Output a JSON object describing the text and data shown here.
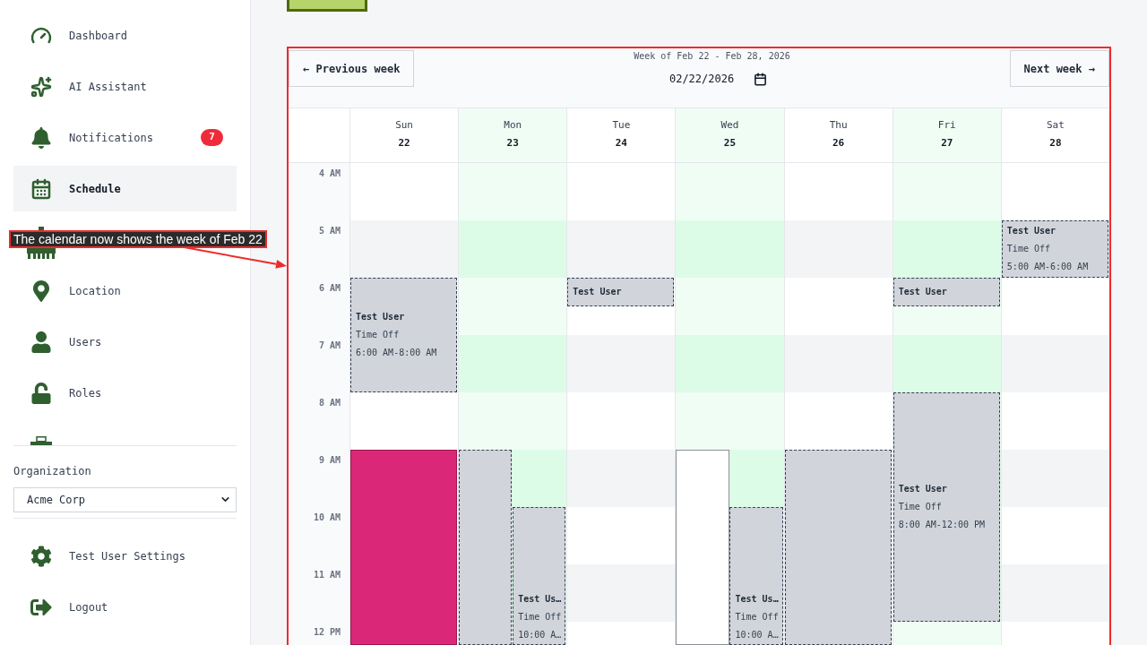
{
  "sidebar": {
    "nav_items": [
      {
        "kind": "link",
        "label": "Dashboard",
        "selected": false
      },
      {
        "kind": "link",
        "label": "AI Assistant",
        "selected": false
      },
      {
        "kind": "link",
        "label": "Notifications",
        "selected": false,
        "badge": "7"
      },
      {
        "kind": "link",
        "label": "Schedule",
        "selected": true
      },
      {
        "kind": "covered",
        "selected": false
      },
      {
        "kind": "link",
        "label": "Location",
        "selected": false
      },
      {
        "kind": "link",
        "label": "Users",
        "selected": false
      },
      {
        "kind": "link",
        "label": "Roles",
        "selected": false
      },
      {
        "kind": "clipped",
        "selected": false
      }
    ],
    "organization": {
      "label": "Organization",
      "value": "Acme Corp"
    },
    "footer_items": [
      {
        "label": "Test User Settings"
      },
      {
        "label": "Logout"
      }
    ]
  },
  "calendar": {
    "prev_button": "← Previous week",
    "range_label": "Week of Feb 22 - Feb 28, 2026",
    "date_value": "02/22/2026",
    "next_button": "Next week →",
    "hours": [
      "4 AM",
      "5 AM",
      "6 AM",
      "7 AM",
      "8 AM",
      "9 AM",
      "10 AM",
      "11 AM",
      "12 PM"
    ],
    "days": [
      {
        "name": "Sun",
        "date": "22",
        "highlighted": false,
        "lanes": [
          {
            "slots": [
              {
                "kind": "free"
              },
              {
                "kind": "free"
              },
              {
                "kind": "free"
              },
              {
                "kind": "free"
              },
              {
                "kind": "time_off",
                "title": "Test User",
                "type": "Time Off",
                "time": "6:00 AM-8:00 AM"
              },
              {
                "kind": "more"
              },
              {
                "kind": "more"
              },
              {
                "kind": "more"
              },
              {
                "kind": "free"
              },
              {
                "kind": "free"
              },
              {
                "kind": "shift",
                "color": "#db2777"
              },
              {
                "kind": "more"
              },
              {
                "kind": "more"
              },
              {
                "kind": "more"
              },
              {
                "kind": "more"
              },
              {
                "kind": "more"
              },
              {
                "kind": "more"
              }
            ]
          }
        ]
      },
      {
        "name": "Mon",
        "date": "23",
        "highlighted": true,
        "lanes": [
          {
            "slots": [
              {
                "kind": "free"
              },
              {
                "kind": "free"
              },
              {
                "kind": "free"
              },
              {
                "kind": "free"
              },
              {
                "kind": "free"
              },
              {
                "kind": "free"
              },
              {
                "kind": "free"
              },
              {
                "kind": "free"
              },
              {
                "kind": "free"
              },
              {
                "kind": "free"
              },
              {
                "kind": "time_off"
              },
              {
                "kind": "more"
              },
              {
                "kind": "more"
              },
              {
                "kind": "more"
              },
              {
                "kind": "more"
              },
              {
                "kind": "more"
              },
              {
                "kind": "more"
              }
            ]
          },
          {
            "slots": [
              {
                "kind": "free"
              },
              {
                "kind": "free"
              },
              {
                "kind": "free"
              },
              {
                "kind": "free"
              },
              {
                "kind": "free"
              },
              {
                "kind": "free"
              },
              {
                "kind": "free"
              },
              {
                "kind": "free"
              },
              {
                "kind": "free"
              },
              {
                "kind": "free"
              },
              {
                "kind": "free"
              },
              {
                "kind": "free"
              },
              {
                "kind": "time_off",
                "title": "Test Us…",
                "type": "Time Off",
                "time": "10:00 A…"
              },
              {
                "kind": "more"
              },
              {
                "kind": "more"
              },
              {
                "kind": "more"
              },
              {
                "kind": "more"
              }
            ]
          }
        ]
      },
      {
        "name": "Tue",
        "date": "24",
        "highlighted": false,
        "lanes": [
          {
            "slots": [
              {
                "kind": "free"
              },
              {
                "kind": "free"
              },
              {
                "kind": "free"
              },
              {
                "kind": "free"
              },
              {
                "kind": "time_off",
                "title": "Test User"
              },
              {
                "kind": "free"
              },
              {
                "kind": "free"
              },
              {
                "kind": "free"
              },
              {
                "kind": "free"
              },
              {
                "kind": "free"
              },
              {
                "kind": "free"
              },
              {
                "kind": "free"
              },
              {
                "kind": "free"
              },
              {
                "kind": "free"
              },
              {
                "kind": "free"
              },
              {
                "kind": "free"
              },
              {
                "kind": "free"
              }
            ]
          }
        ]
      },
      {
        "name": "Wed",
        "date": "25",
        "highlighted": true,
        "lanes": [
          {
            "slots": [
              {
                "kind": "free"
              },
              {
                "kind": "free"
              },
              {
                "kind": "free"
              },
              {
                "kind": "free"
              },
              {
                "kind": "free"
              },
              {
                "kind": "free"
              },
              {
                "kind": "free"
              },
              {
                "kind": "free"
              },
              {
                "kind": "free"
              },
              {
                "kind": "free"
              },
              {
                "kind": "open"
              },
              {
                "kind": "more"
              },
              {
                "kind": "more"
              },
              {
                "kind": "more"
              },
              {
                "kind": "more"
              },
              {
                "kind": "more"
              },
              {
                "kind": "more"
              }
            ]
          },
          {
            "slots": [
              {
                "kind": "free"
              },
              {
                "kind": "free"
              },
              {
                "kind": "free"
              },
              {
                "kind": "free"
              },
              {
                "kind": "free"
              },
              {
                "kind": "free"
              },
              {
                "kind": "free"
              },
              {
                "kind": "free"
              },
              {
                "kind": "free"
              },
              {
                "kind": "free"
              },
              {
                "kind": "free"
              },
              {
                "kind": "free"
              },
              {
                "kind": "time_off",
                "title": "Test Us…",
                "type": "Time Off",
                "time": "10:00 A…"
              },
              {
                "kind": "more"
              },
              {
                "kind": "more"
              },
              {
                "kind": "more"
              },
              {
                "kind": "more"
              }
            ]
          }
        ]
      },
      {
        "name": "Thu",
        "date": "26",
        "highlighted": false,
        "lanes": [
          {
            "slots": [
              {
                "kind": "free"
              },
              {
                "kind": "free"
              },
              {
                "kind": "free"
              },
              {
                "kind": "free"
              },
              {
                "kind": "free"
              },
              {
                "kind": "free"
              },
              {
                "kind": "free"
              },
              {
                "kind": "free"
              },
              {
                "kind": "free"
              },
              {
                "kind": "free"
              },
              {
                "kind": "time_off"
              },
              {
                "kind": "more"
              },
              {
                "kind": "more"
              },
              {
                "kind": "more"
              },
              {
                "kind": "more"
              },
              {
                "kind": "more"
              },
              {
                "kind": "more"
              }
            ]
          }
        ]
      },
      {
        "name": "Fri",
        "date": "27",
        "highlighted": true,
        "lanes": [
          {
            "slots": [
              {
                "kind": "free"
              },
              {
                "kind": "free"
              },
              {
                "kind": "free"
              },
              {
                "kind": "free"
              },
              {
                "kind": "time_off",
                "title": "Test User"
              },
              {
                "kind": "free"
              },
              {
                "kind": "free"
              },
              {
                "kind": "free"
              },
              {
                "kind": "time_off",
                "title": "Test User",
                "type": "Time Off",
                "time": "8:00 AM-12:00 PM"
              },
              {
                "kind": "more"
              },
              {
                "kind": "more"
              },
              {
                "kind": "more"
              },
              {
                "kind": "more"
              },
              {
                "kind": "more"
              },
              {
                "kind": "more"
              },
              {
                "kind": "more"
              },
              {
                "kind": "free"
              }
            ]
          }
        ]
      },
      {
        "name": "Sat",
        "date": "28",
        "highlighted": false,
        "lanes": [
          {
            "slots": [
              {
                "kind": "free"
              },
              {
                "kind": "free"
              },
              {
                "kind": "time_off",
                "title": "Test User",
                "type": "Time Off",
                "time": "5:00 AM-6:00 AM"
              },
              {
                "kind": "more"
              },
              {
                "kind": "free"
              },
              {
                "kind": "free"
              },
              {
                "kind": "free"
              },
              {
                "kind": "free"
              },
              {
                "kind": "free"
              },
              {
                "kind": "free"
              },
              {
                "kind": "free"
              },
              {
                "kind": "free"
              },
              {
                "kind": "free"
              },
              {
                "kind": "free"
              },
              {
                "kind": "free"
              },
              {
                "kind": "free"
              },
              {
                "kind": "free"
              }
            ]
          }
        ]
      }
    ]
  },
  "annotation": {
    "text": "The calendar now shows the week of Feb 22"
  }
}
